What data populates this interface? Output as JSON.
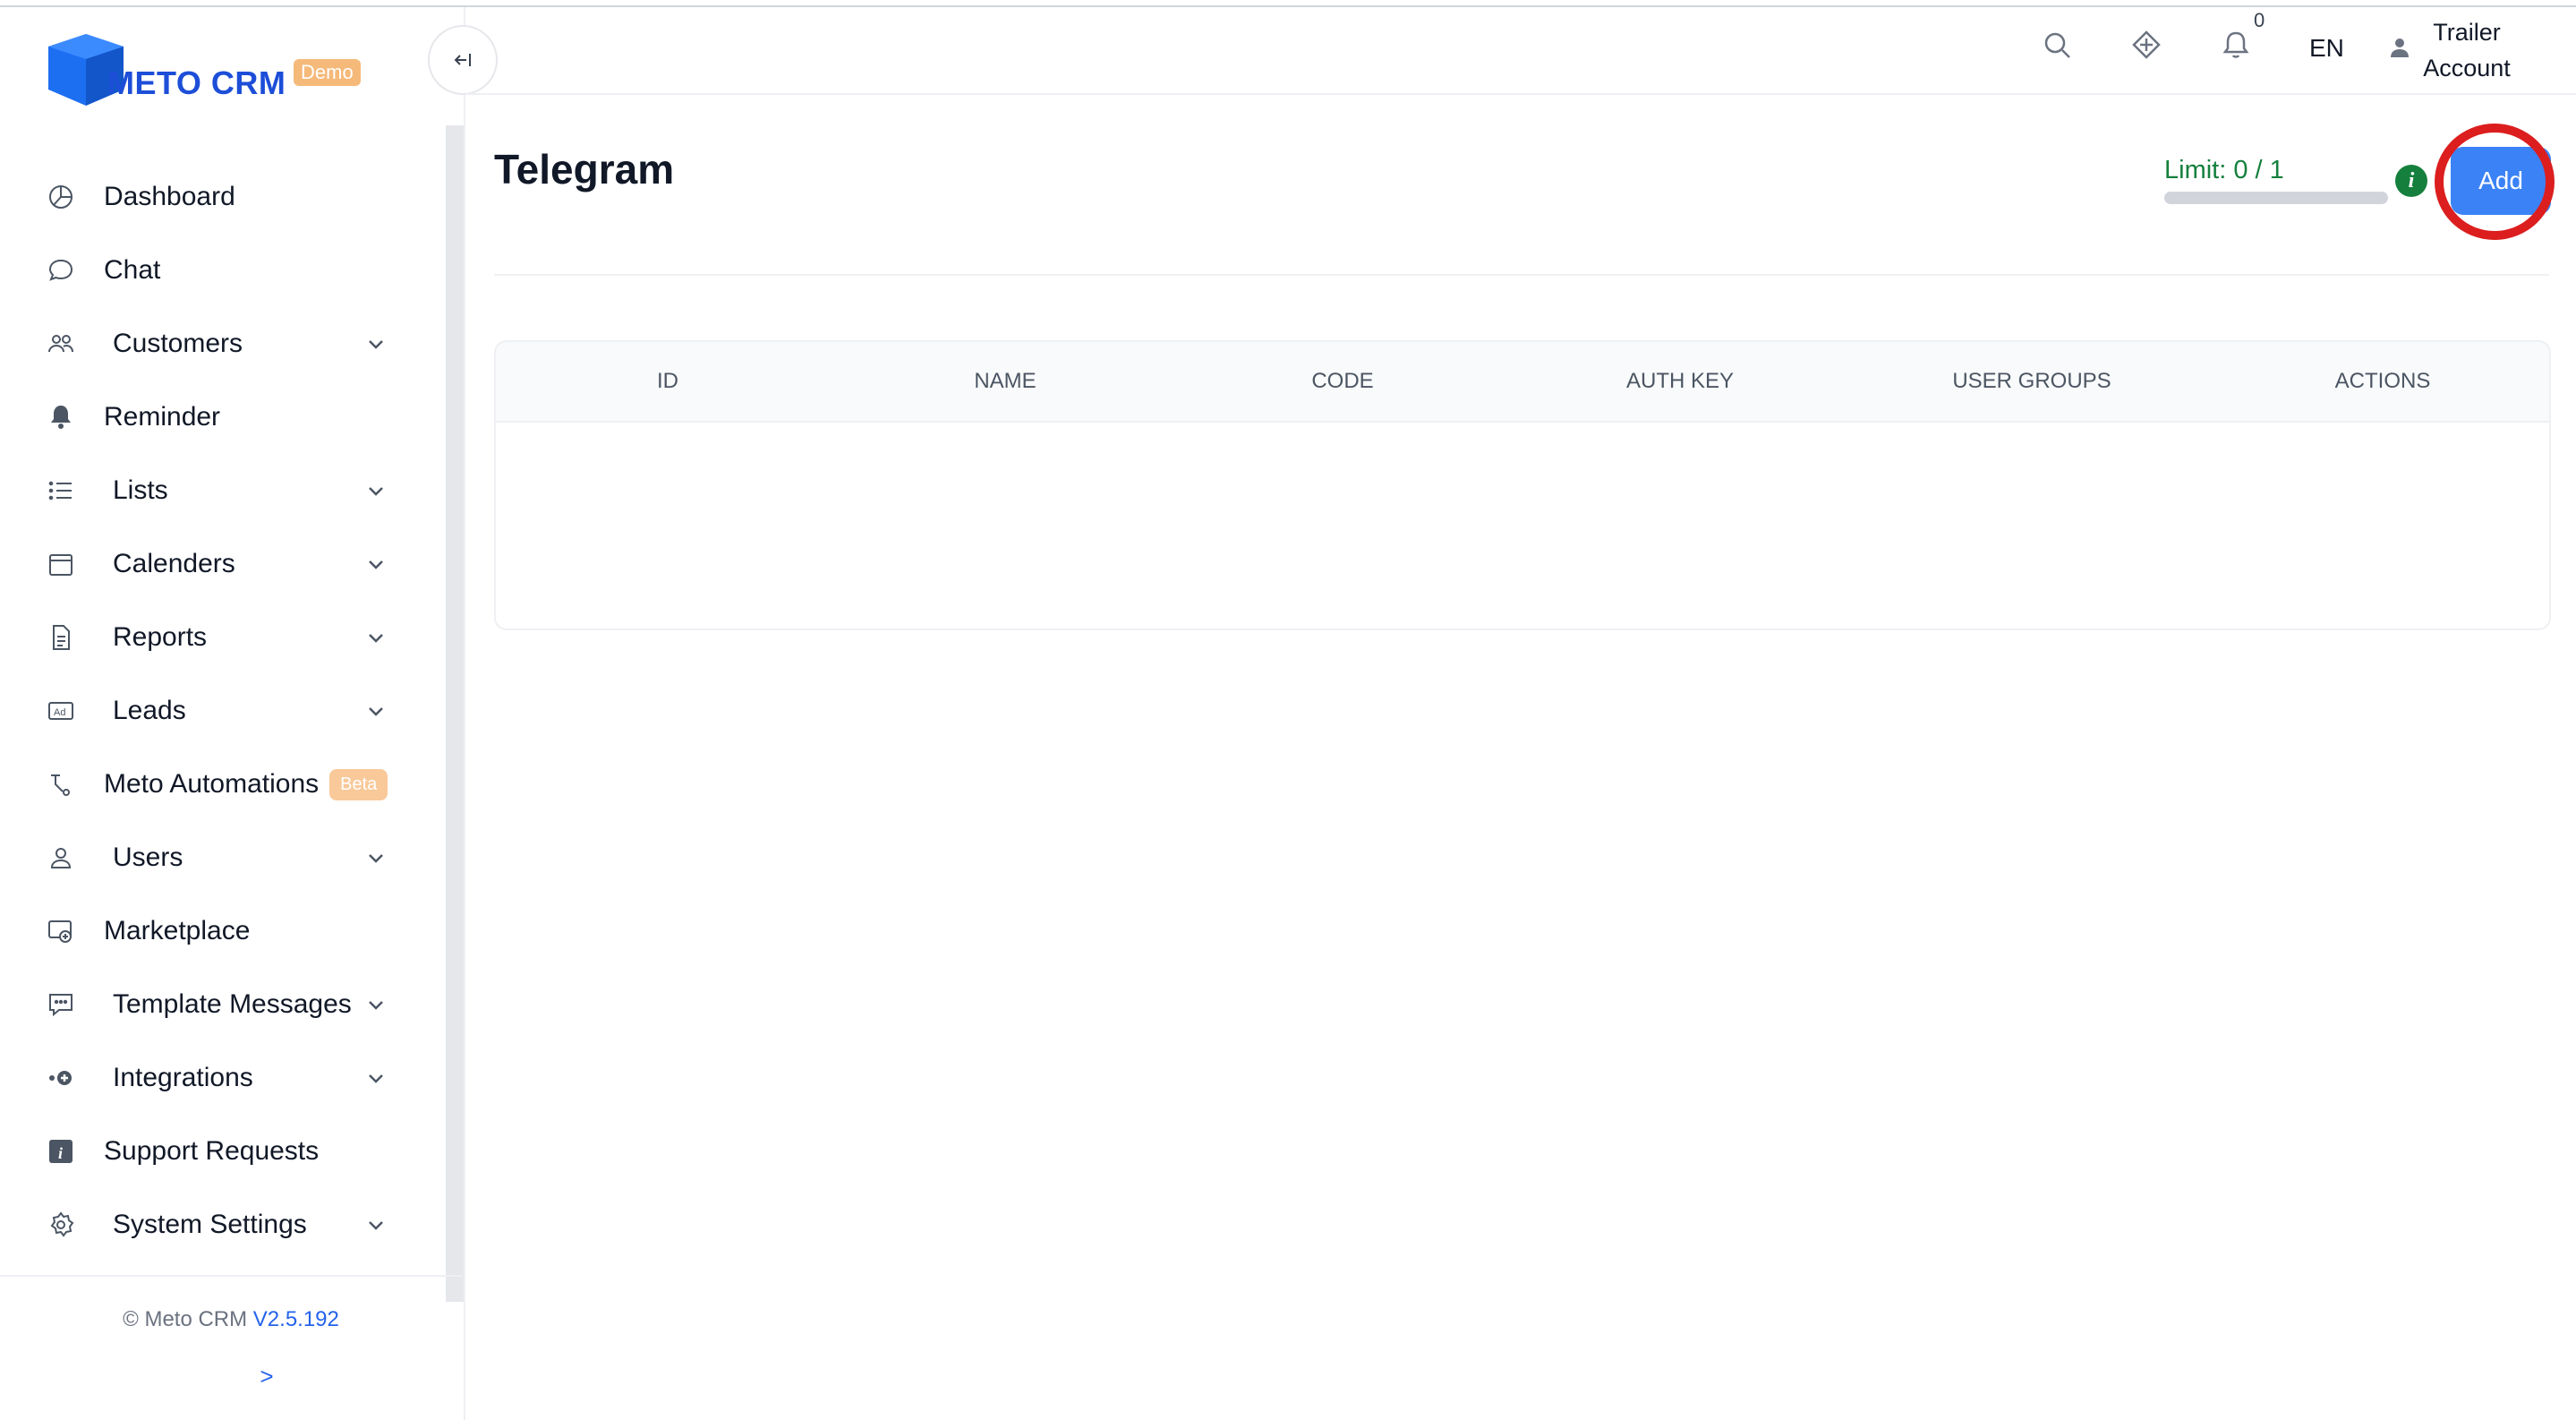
{
  "brand": {
    "name": "METO CRM",
    "badge": "Demo"
  },
  "sidebar": {
    "items": [
      {
        "label": "Dashboard",
        "icon": "dashboard-icon",
        "has_submenu": false
      },
      {
        "label": "Chat",
        "icon": "chat-icon",
        "has_submenu": false
      },
      {
        "label": "Customers",
        "icon": "customers-icon",
        "has_submenu": true
      },
      {
        "label": "Reminder",
        "icon": "bell-icon",
        "has_submenu": false
      },
      {
        "label": "Lists",
        "icon": "list-icon",
        "has_submenu": true
      },
      {
        "label": "Calenders",
        "icon": "calendar-icon",
        "has_submenu": true
      },
      {
        "label": "Reports",
        "icon": "report-icon",
        "has_submenu": true
      },
      {
        "label": "Leads",
        "icon": "ad-icon",
        "has_submenu": true
      },
      {
        "label": "Meto Automations",
        "icon": "automation-icon",
        "has_submenu": false,
        "badge": "Beta"
      },
      {
        "label": "Users",
        "icon": "user-icon",
        "has_submenu": true
      },
      {
        "label": "Marketplace",
        "icon": "marketplace-icon",
        "has_submenu": false
      },
      {
        "label": "Template Messages",
        "icon": "message-template-icon",
        "has_submenu": true
      },
      {
        "label": "Integrations",
        "icon": "integration-icon",
        "has_submenu": true
      },
      {
        "label": "Support Requests",
        "icon": "info-icon",
        "has_submenu": false
      },
      {
        "label": "System Settings",
        "icon": "gear-icon",
        "has_submenu": true
      }
    ],
    "copyright": "© Meto CRM",
    "version": "V2.5.192",
    "expand_label": ">"
  },
  "topbar": {
    "notification_count": "0",
    "language": "EN",
    "account_line1": "Trailer",
    "account_line2": "Account"
  },
  "page": {
    "title": "Telegram",
    "limit_label": "Limit: 0 / 1",
    "limit_used": 0,
    "limit_max": 1,
    "add_button": "Add"
  },
  "table": {
    "columns": [
      "ID",
      "NAME",
      "CODE",
      "AUTH KEY",
      "USER GROUPS",
      "ACTIONS"
    ],
    "rows": []
  },
  "colors": {
    "accent": "#3b82f6",
    "brand": "#1d4ed8",
    "limit_text": "#15803d",
    "highlight": "#dc1e1e"
  }
}
